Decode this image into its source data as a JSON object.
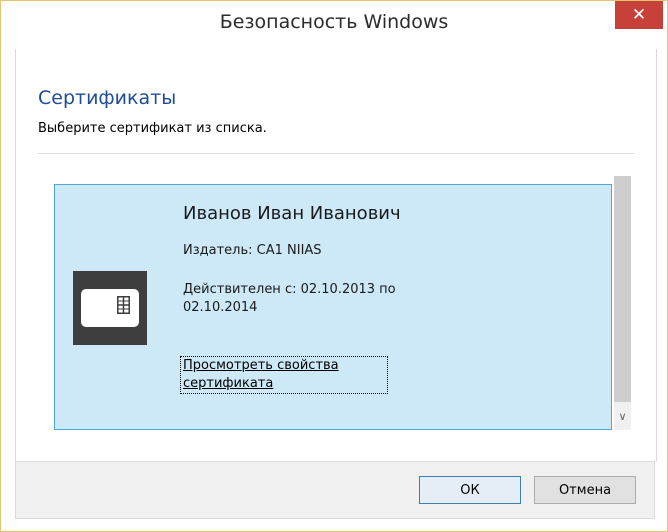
{
  "window": {
    "title": "Безопасность Windows",
    "close_symbol": "✕"
  },
  "header": {
    "heading": "Сертификаты",
    "subheading": "Выберите сертификат из списка."
  },
  "certificate": {
    "name": "Иванов Иван Иванович",
    "issuer": "Издатель: CA1 NIIAS",
    "validity": "Действителен с: 02.10.2013 по 02.10.2014",
    "view_link": "Просмотреть свойства сертификата",
    "icon": "smart-card-icon"
  },
  "scrollbar": {
    "down_arrow": "∨"
  },
  "buttons": {
    "ok": "ОК",
    "cancel": "Отмена"
  },
  "colors": {
    "accent_heading": "#1e4c96",
    "selection_fill": "#cde8f7",
    "selection_border": "#4fa6dc",
    "close_button": "#c7403a"
  }
}
